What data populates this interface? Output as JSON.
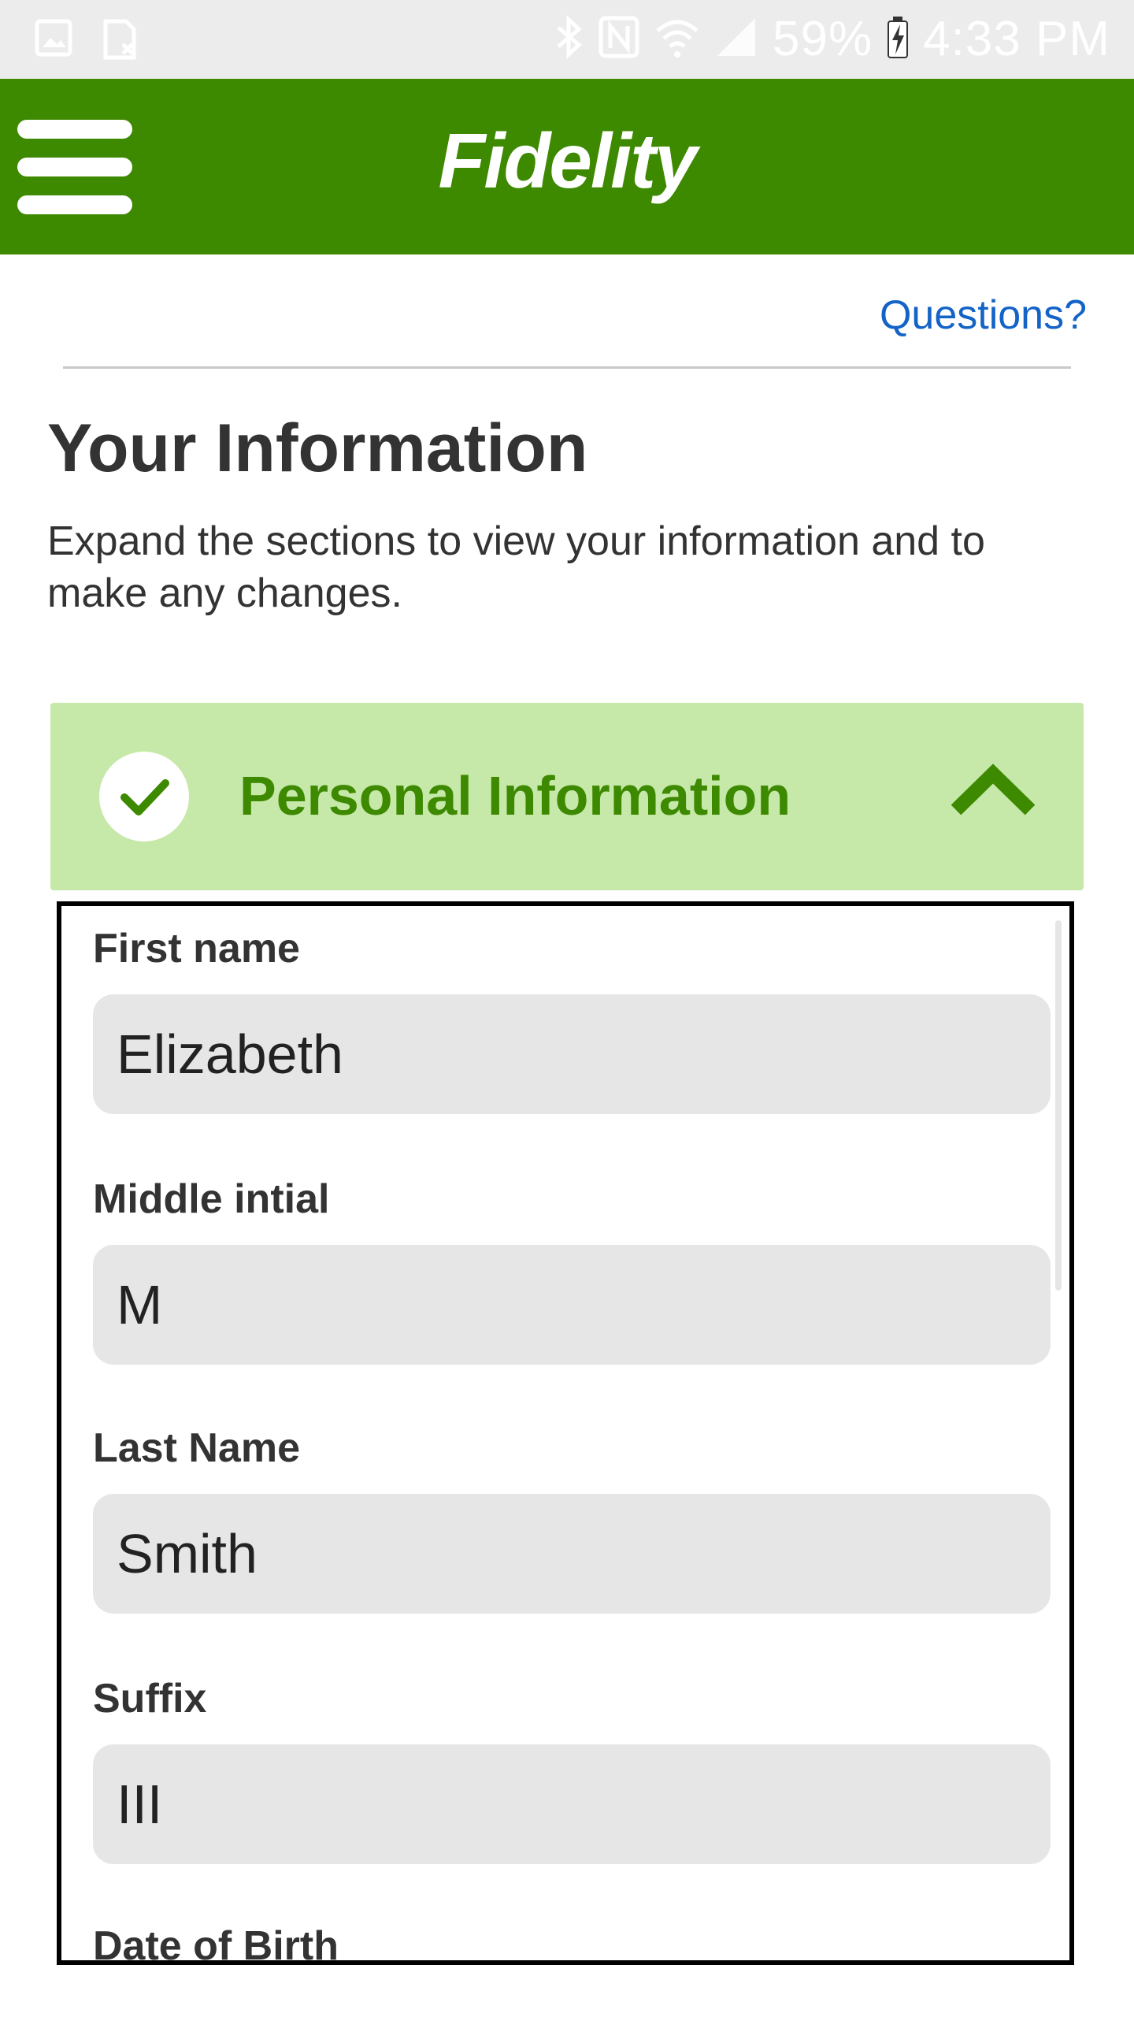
{
  "status_bar": {
    "battery": "59%",
    "time": "4:33 PM"
  },
  "header": {
    "logo_text": "Fidelity",
    "menu_icon": "hamburger-menu-icon"
  },
  "help": {
    "questions_link": "Questions?"
  },
  "page": {
    "title": "Your Information",
    "description": "Expand the sections to view your information and to make any changes."
  },
  "section": {
    "title": "Personal Information",
    "status_icon": "check-circle-icon",
    "toggle_icon": "chevron-up-icon",
    "expanded": true
  },
  "form": {
    "fields": [
      {
        "label": "First name",
        "value": "Elizabeth"
      },
      {
        "label": "Middle intial",
        "value": "M"
      },
      {
        "label": "Last Name",
        "value": "Smith"
      },
      {
        "label": "Suffix",
        "value": "III"
      },
      {
        "label": "Date of Birth"
      }
    ]
  },
  "colors": {
    "brand_green": "#3d8900",
    "section_bg": "#c6e8a8",
    "link_blue": "#1463c7",
    "input_bg": "#e6e6e6"
  }
}
